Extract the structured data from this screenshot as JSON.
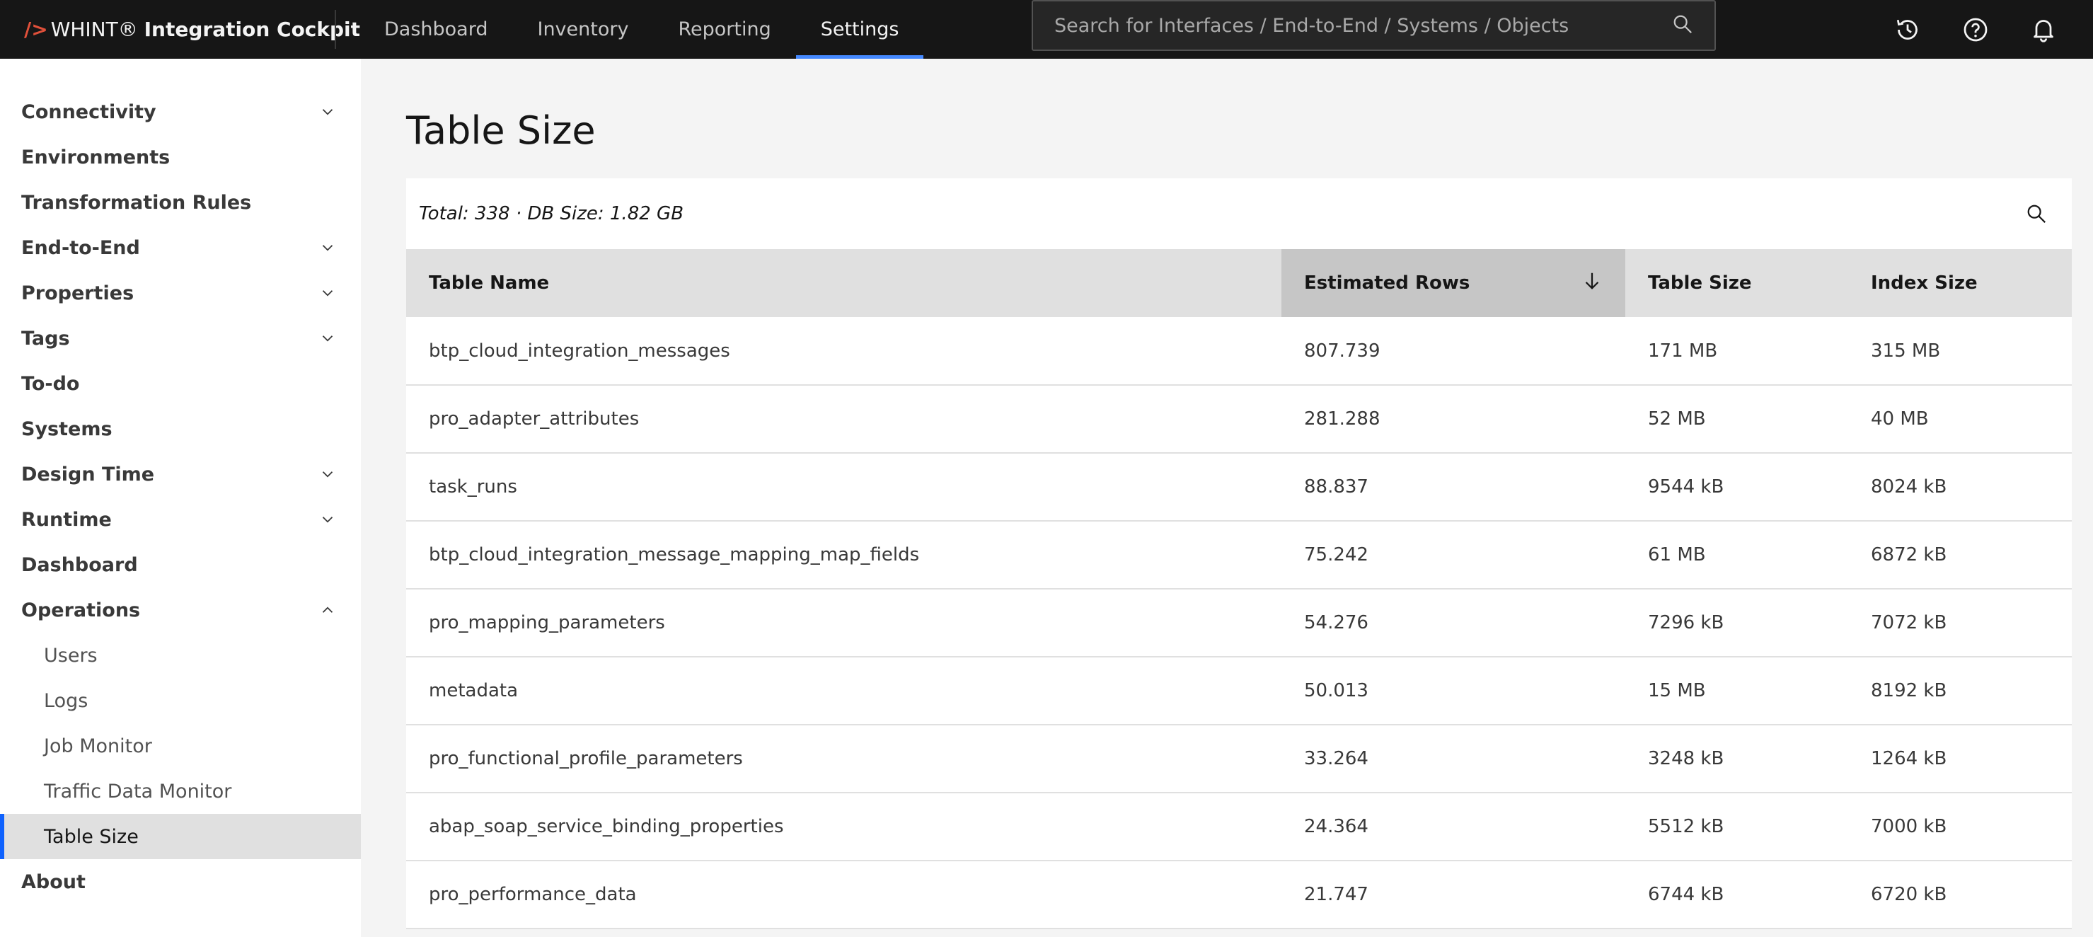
{
  "header": {
    "brand_mark": "/>",
    "brand_prefix": "WHINT®",
    "brand_bold": "Integration Cockpit",
    "nav": [
      {
        "label": "Dashboard"
      },
      {
        "label": "Inventory"
      },
      {
        "label": "Reporting"
      },
      {
        "label": "Settings",
        "active": true
      }
    ],
    "search_placeholder": "Search for Interfaces / End-to-End / Systems / Objects",
    "icons": [
      "history-icon",
      "help-icon",
      "notification-icon"
    ]
  },
  "sidebar": {
    "items": [
      {
        "label": "Connectivity",
        "chevron": "down"
      },
      {
        "label": "Environments"
      },
      {
        "label": "Transformation Rules"
      },
      {
        "label": "End-to-End",
        "chevron": "down"
      },
      {
        "label": "Properties",
        "chevron": "down"
      },
      {
        "label": "Tags",
        "chevron": "down"
      },
      {
        "label": "To-do"
      },
      {
        "label": "Systems"
      },
      {
        "label": "Design Time",
        "chevron": "down"
      },
      {
        "label": "Runtime",
        "chevron": "down"
      },
      {
        "label": "Dashboard"
      },
      {
        "label": "Operations",
        "chevron": "up"
      },
      {
        "label": "Users",
        "sub": true
      },
      {
        "label": "Logs",
        "sub": true
      },
      {
        "label": "Job Monitor",
        "sub": true
      },
      {
        "label": "Traffic Data Monitor",
        "sub": true
      },
      {
        "label": "Table Size",
        "sub": true,
        "selected": true
      },
      {
        "label": "About"
      }
    ]
  },
  "main": {
    "title": "Table Size",
    "summary": "Total: 338 · DB Size: 1.82 GB",
    "columns": [
      "Table Name",
      "Estimated Rows",
      "Table Size",
      "Index Size"
    ],
    "sorted_column": "Estimated Rows",
    "sort_direction": "descending",
    "rows": [
      [
        "btp_cloud_integration_messages",
        "807.739",
        "171 MB",
        "315 MB"
      ],
      [
        "pro_adapter_attributes",
        "281.288",
        "52 MB",
        "40 MB"
      ],
      [
        "task_runs",
        "88.837",
        "9544 kB",
        "8024 kB"
      ],
      [
        "btp_cloud_integration_message_mapping_map_fields",
        "75.242",
        "61 MB",
        "6872 kB"
      ],
      [
        "pro_mapping_parameters",
        "54.276",
        "7296 kB",
        "7072 kB"
      ],
      [
        "metadata",
        "50.013",
        "15 MB",
        "8192 kB"
      ],
      [
        "pro_functional_profile_parameters",
        "33.264",
        "3248 kB",
        "1264 kB"
      ],
      [
        "abap_soap_service_binding_properties",
        "24.364",
        "5512 kB",
        "7000 kB"
      ],
      [
        "pro_performance_data",
        "21.747",
        "6744 kB",
        "6720 kB"
      ]
    ]
  }
}
